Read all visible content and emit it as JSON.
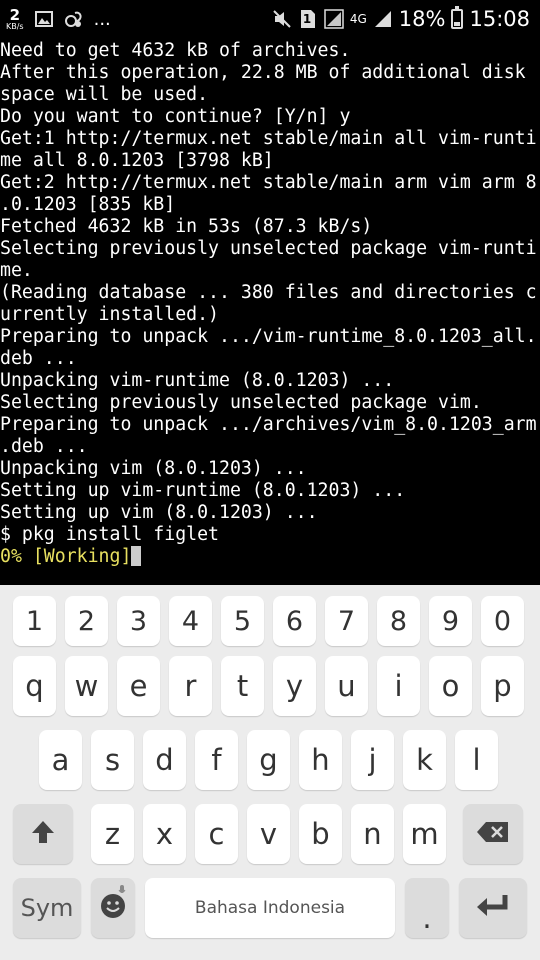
{
  "status_bar": {
    "net_speed_value": "2",
    "net_speed_unit": "KB/s",
    "more_indicator": "...",
    "network_type": "4G",
    "battery_percent": "18%",
    "time": "15:08",
    "sim_badge": "1"
  },
  "terminal": {
    "lines": [
      "Need to get 4632 kB of archives.",
      "After this operation, 22.8 MB of additional disk",
      "space will be used.",
      "Do you want to continue? [Y/n] y",
      "Get:1 http://termux.net stable/main all vim-runti",
      "me all 8.0.1203 [3798 kB]",
      "Get:2 http://termux.net stable/main arm vim arm 8",
      ".0.1203 [835 kB]",
      "Fetched 4632 kB in 53s (87.3 kB/s)",
      "Selecting previously unselected package vim-runti",
      "me.",
      "(Reading database ... 380 files and directories c",
      "urrently installed.)",
      "Preparing to unpack .../vim-runtime_8.0.1203_all.",
      "deb ...",
      "Unpacking vim-runtime (8.0.1203) ...",
      "Selecting previously unselected package vim.",
      "Preparing to unpack .../archives/vim_8.0.1203_arm",
      ".deb ...",
      "Unpacking vim (8.0.1203) ...",
      "Setting up vim-runtime (8.0.1203) ...",
      "Setting up vim (8.0.1203) ...",
      "$ pkg install figlet"
    ],
    "progress_line": "0% [Working]",
    "progress_color": "#e8e060"
  },
  "keyboard": {
    "numbers": [
      "1",
      "2",
      "3",
      "4",
      "5",
      "6",
      "7",
      "8",
      "9",
      "0"
    ],
    "row1": [
      "q",
      "w",
      "e",
      "r",
      "t",
      "y",
      "u",
      "i",
      "o",
      "p"
    ],
    "row2": [
      "a",
      "s",
      "d",
      "f",
      "g",
      "h",
      "j",
      "k",
      "l"
    ],
    "row3": [
      "z",
      "x",
      "c",
      "v",
      "b",
      "n",
      "m"
    ],
    "sym_label": "Sym",
    "space_label": "Bahasa Indonesia",
    "period_label": ".",
    "shift_icon": "shift-arrow-icon",
    "backspace_icon": "backspace-icon",
    "enter_icon": "enter-icon",
    "emoji_icon": "emoji-icon",
    "mic_icon": "microphone-icon"
  }
}
